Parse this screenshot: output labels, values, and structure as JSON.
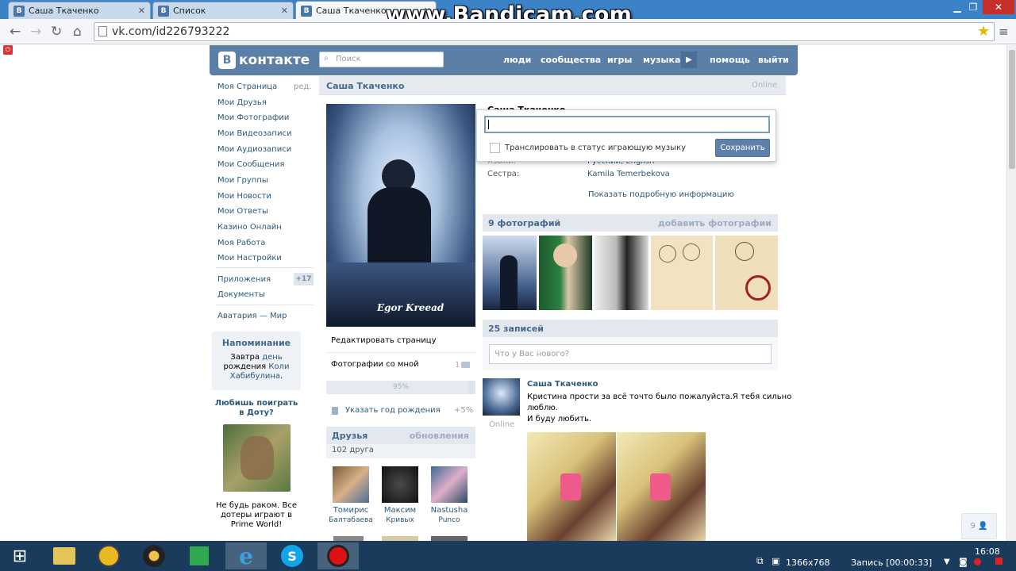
{
  "browser": {
    "tabs": [
      {
        "label": "Саша Ткаченко",
        "active": false
      },
      {
        "label": "Список",
        "active": false
      },
      {
        "label": "Саша Ткаченко",
        "active": true
      }
    ],
    "url": "vk.com/id226793222"
  },
  "watermark": "www.Bandicam.com",
  "vk": {
    "logo": "контакте",
    "logo_letter": "В",
    "search_placeholder": "Поиск",
    "nav": [
      "люди",
      "сообщества",
      "игры",
      "музыка",
      "помощь",
      "выйти"
    ],
    "menu": [
      "Моя Страница",
      "Мои Друзья",
      "Мои Фотографии",
      "Мои Видеозаписи",
      "Мои Аудиозаписи",
      "Мои Сообщения",
      "Мои Группы",
      "Мои Новости",
      "Мои Ответы",
      "Казино Онлайн",
      "Моя Работа",
      "Мои Настройки"
    ],
    "menu_edit": "ред.",
    "menu2": [
      "Приложения",
      "Документы"
    ],
    "apps_count": "+17",
    "avataria": "Аватария — Мир",
    "reminder": {
      "title": "Напоминание",
      "line1": "Завтра",
      "line1b": "день",
      "line2": "рождения",
      "name": "Коли",
      "name2": "Хабибулина",
      "end": "."
    },
    "ad": {
      "title": "Любишь поиграть в Доту?",
      "text": "Не будь раком. Все дотеры играют в Prime World!"
    }
  },
  "profile": {
    "name": "Саша Ткаченко",
    "online": "Online",
    "avatar_caption": "Egor Kreead",
    "edit_page": "Редактировать страницу",
    "photos_with_me": "Фотографии со мной",
    "photos_with_me_count": "1",
    "progress": "95%",
    "progress_value": 0.95,
    "birthday_hint": "Указать год рождения",
    "birthday_bonus": "+5%",
    "friends_title": "Друзья",
    "friends_updates": "обновления",
    "friends_count": "102 друга",
    "friends": [
      {
        "first": "Томирис",
        "last": "Балтабаева"
      },
      {
        "first": "Максим",
        "last": "Кривых"
      },
      {
        "first": "Nastusha",
        "last": "Punco"
      }
    ],
    "info_name_partial": "Саша Ткаченко",
    "languages_label": "Языки:",
    "languages_value": "Русский, English",
    "sister_label": "Сестра:",
    "sister_value": "Kamila Temerbekova",
    "details_link": "Показать подробную информацию",
    "photos_title": "9 фотографий",
    "add_photos": "добавить фотографии",
    "posts_title": "25 записей",
    "whats_new_placeholder": "Что у Вас нового?",
    "post": {
      "author": "Саша Ткаченко",
      "online": "Online",
      "text1": "Кристина прости за всё точто было пожалуйста.Я тебя сильно",
      "text2": "люблю.",
      "text3": "И буду любить."
    }
  },
  "status_popup": {
    "checkbox_label": "Транслировать в статус играющую музыку",
    "save": "Сохранить"
  },
  "im_counter": "9",
  "taskbar": {
    "resolution": "1366x768",
    "recording": "Запись [00:00:33]",
    "time": "16:08"
  }
}
